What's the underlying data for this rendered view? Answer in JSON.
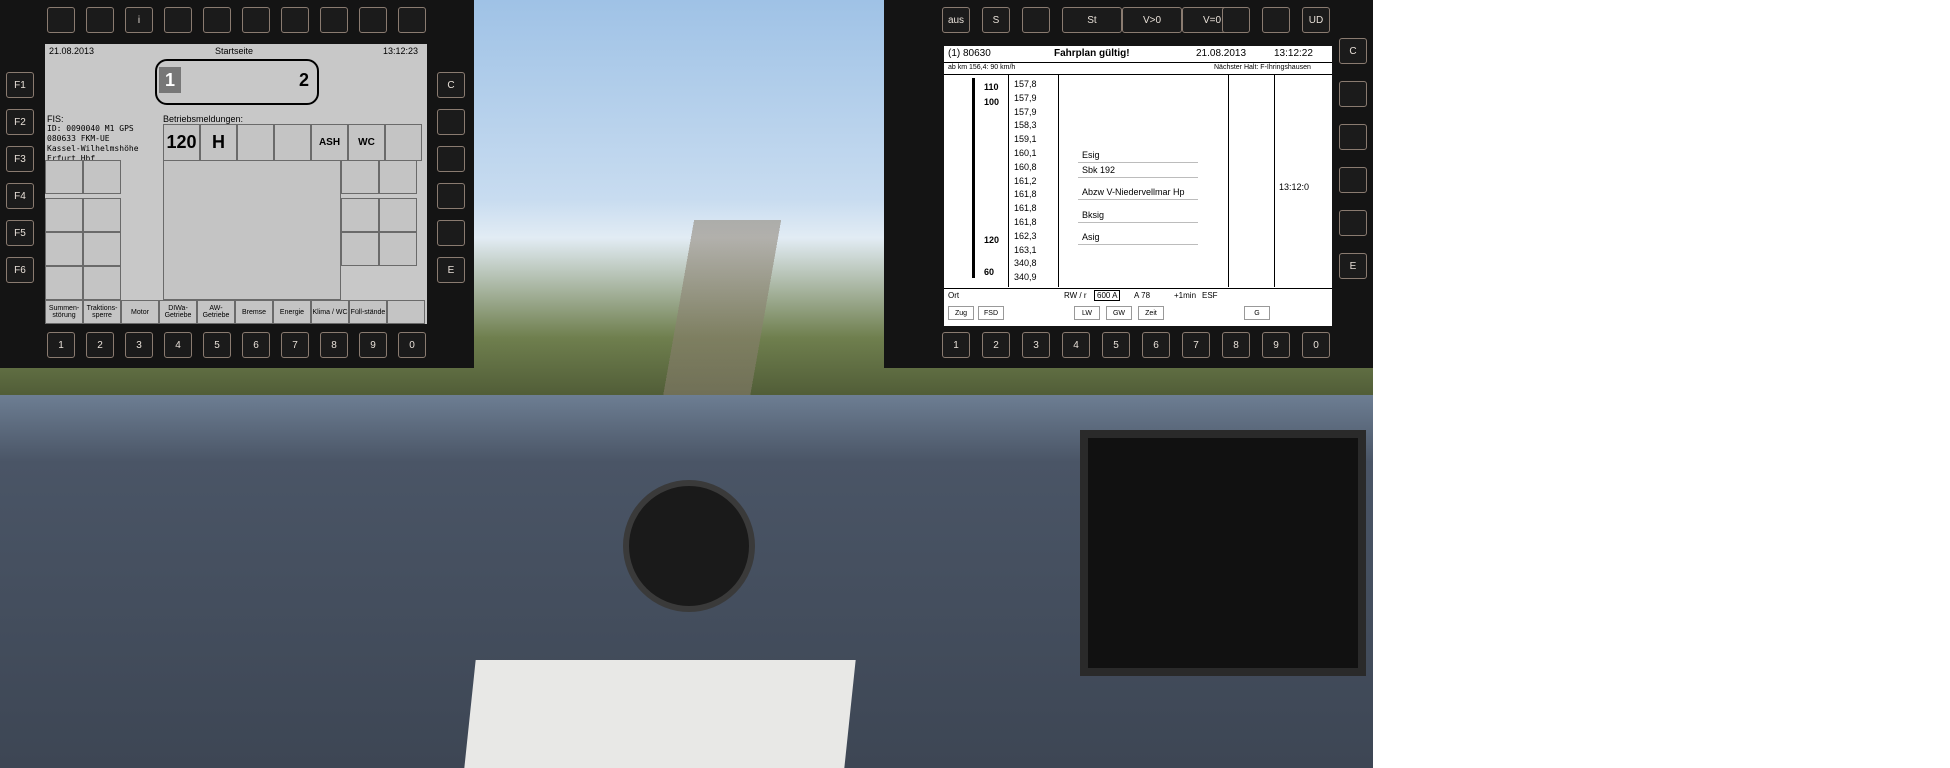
{
  "left_dmi": {
    "top_keys": [
      "",
      "",
      "i",
      "",
      "",
      "",
      "",
      "",
      "",
      ""
    ],
    "fn_keys": [
      "F1",
      "F2",
      "F3",
      "F4",
      "F5",
      "F6"
    ],
    "nav_keys": [
      "C",
      "",
      "",
      "",
      "",
      "E"
    ],
    "bottom_keys": [
      "1",
      "2",
      "3",
      "4",
      "5",
      "6",
      "7",
      "8",
      "9",
      "0"
    ],
    "date": "21.08.2013",
    "title": "Startseite",
    "time": "13:12:23",
    "train_end_1": "1",
    "train_end_2": "2",
    "fis_label": "FIS:",
    "fis_lines": [
      "ID: 0090040 M1  GPS",
      "080633 FKM-UE",
      "Kassel-Wilhelmshöhe",
      "Erfurt Hbf"
    ],
    "messages_label": "Betriebsmeldungen:",
    "status_row": [
      "120",
      "H",
      "",
      "",
      "ASH",
      "WC",
      ""
    ],
    "bottom_tabs": [
      "Summen-störung",
      "Traktions-sperre",
      "Motor",
      "DIWa-Getriebe",
      "AW-Getriebe",
      "Bremse",
      "Energie",
      "Klima / WC",
      "Füll-stände",
      ""
    ]
  },
  "right_dmi": {
    "top_keys": [
      "aus",
      "S",
      "",
      "St",
      "V>0",
      "V=0",
      "",
      "",
      "UD"
    ],
    "nav_keys": [
      "C",
      "",
      "",
      "",
      "",
      "E"
    ],
    "bottom_keys": [
      "1",
      "2",
      "3",
      "4",
      "5",
      "6",
      "7",
      "8",
      "9",
      "0"
    ],
    "header_id": "(1) 80630",
    "header_status": "Fahrplan gültig!",
    "header_date": "21.08.2013",
    "header_time": "13:12:22",
    "sub_left": "ab km 156,4: 90 km/h",
    "sub_right": "Nächster Halt: F-Ihringshausen",
    "speed_labels": [
      "110",
      "100",
      "120",
      "60"
    ],
    "km_values": [
      "157,8",
      "157,9",
      "157,9",
      "158,3",
      "159,1",
      "160,1",
      "160,8",
      "161,2",
      "161,8",
      "161,8",
      "161,8",
      "162,3",
      "163,1",
      "340,8",
      "340,9"
    ],
    "events": [
      "Esig",
      "Sbk 192",
      "Abzw V-Niedervellmar Hp",
      "Bksig",
      "Asig"
    ],
    "arrival_time": "13:12:0",
    "footer_ort": "Ort",
    "footer_rw": "RW / r",
    "footer_a": "600 A",
    "footer_a78": "A 78",
    "footer_min": "+1min",
    "footer_esf": "ESF",
    "footer_buttons": [
      "Zug",
      "FSD",
      "LW",
      "GW",
      "Zeit",
      "G"
    ]
  }
}
